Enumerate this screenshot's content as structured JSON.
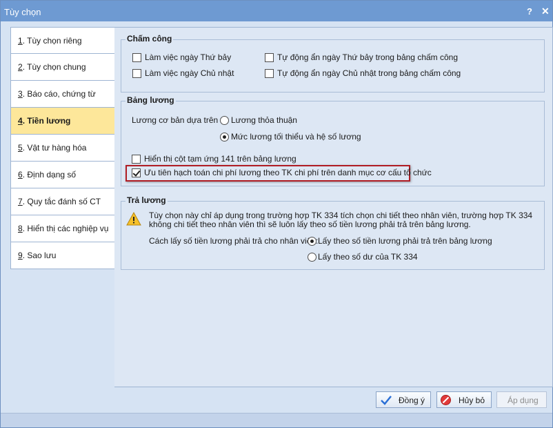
{
  "window": {
    "title": "Tùy chọn",
    "help": "?",
    "close": "✕"
  },
  "sidebar": {
    "items": [
      {
        "num": "1",
        "label": ". Tùy chọn riêng"
      },
      {
        "num": "2",
        "label": ". Tùy chọn chung"
      },
      {
        "num": "3",
        "label": ". Báo cáo, chứng từ"
      },
      {
        "num": "4",
        "label": ". Tiền lương"
      },
      {
        "num": "5",
        "label": ". Vật tư hàng hóa"
      },
      {
        "num": "6",
        "label": ". Định dạng số"
      },
      {
        "num": "7",
        "label": ". Quy tắc đánh số CT"
      },
      {
        "num": "8",
        "label": ". Hiển thị các nghiệp vụ"
      },
      {
        "num": "9",
        "label": ". Sao lưu"
      }
    ]
  },
  "cham_cong": {
    "title": "Chấm công",
    "lam_viec_thu_bay": "Làm việc ngày Thứ bảy",
    "lam_viec_chu_nhat": "Làm việc ngày Chủ nhật",
    "an_thu_bay": "Tự động ẩn ngày Thứ bảy trong bảng chấm công",
    "an_chu_nhat": "Tự động ẩn ngày Chủ nhật trong bảng chấm công"
  },
  "bang_luong": {
    "title": "Bảng lương",
    "luong_co_ban_label": "Lương cơ bản dựa trên",
    "opt_thoa_thuan": "Lương thỏa thuận",
    "opt_toi_thieu": "Mức lương tối thiểu và hệ số lương",
    "hien_thi_tam_ung": "Hiển thị cột tạm ứng 141 trên bảng lương",
    "uu_tien_hach_toan": "Ưu tiên hạch toán chi phí lương theo TK chi phí trên danh mục cơ cấu tổ chức"
  },
  "tra_luong": {
    "title": "Trả lương",
    "note_line1": "Tùy chọn này chỉ áp dụng trong trường hợp TK 334 tích chọn chi tiết theo nhân viên, trường hợp TK 334",
    "note_line2": "không chi tiết theo nhân viên thì sẽ luôn lấy theo số tiền lương phải trả trên bảng lương.",
    "cach_lay_label": "Cách lấy số tiền lương phải trả cho nhân viên:",
    "opt_bang_luong": "Lấy theo số tiền lương phải trả trên bảng lương",
    "opt_so_du": "Lấy theo số dư của TK 334"
  },
  "buttons": {
    "ok": "Đồng ý",
    "cancel": "Hủy bỏ",
    "apply": "Áp dụng"
  },
  "colors": {
    "active_nav": "#fde79a",
    "title_bar": "#6e9ad2",
    "highlight": "#b01c24"
  }
}
